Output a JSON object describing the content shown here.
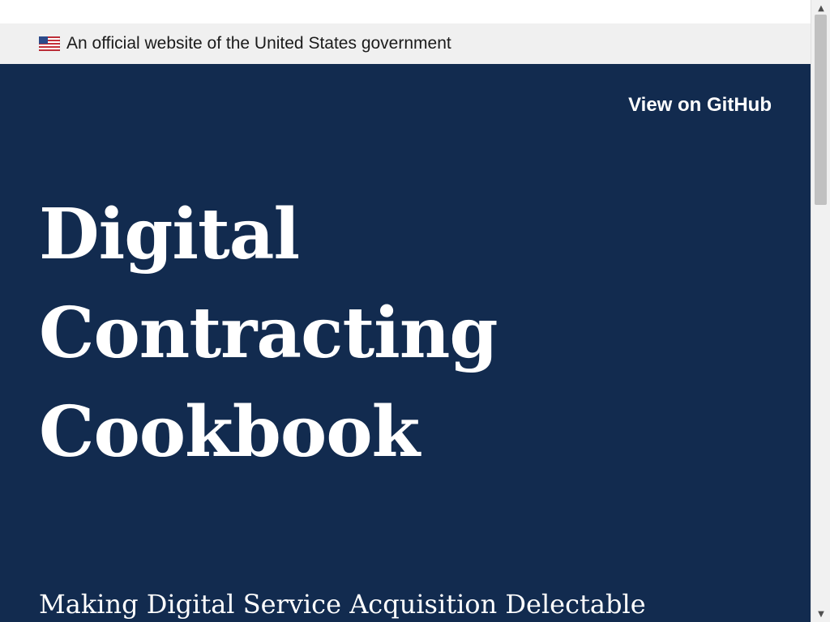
{
  "gov_banner": {
    "flag_icon": "us-flag-icon",
    "text": "An official website of the United States government"
  },
  "header": {
    "github_link": "View on GitHub"
  },
  "hero": {
    "title_lines": [
      "Digital",
      "Contracting",
      "Cookbook"
    ],
    "tagline": "Making Digital Service Acquisition Delectable"
  },
  "colors": {
    "hero_background": "#122b4f",
    "banner_background": "#f0f0f0",
    "text_light": "#ffffff"
  },
  "scrollbar": {
    "up_icon": "scroll-up-arrow-icon",
    "down_icon": "scroll-down-arrow-icon"
  }
}
